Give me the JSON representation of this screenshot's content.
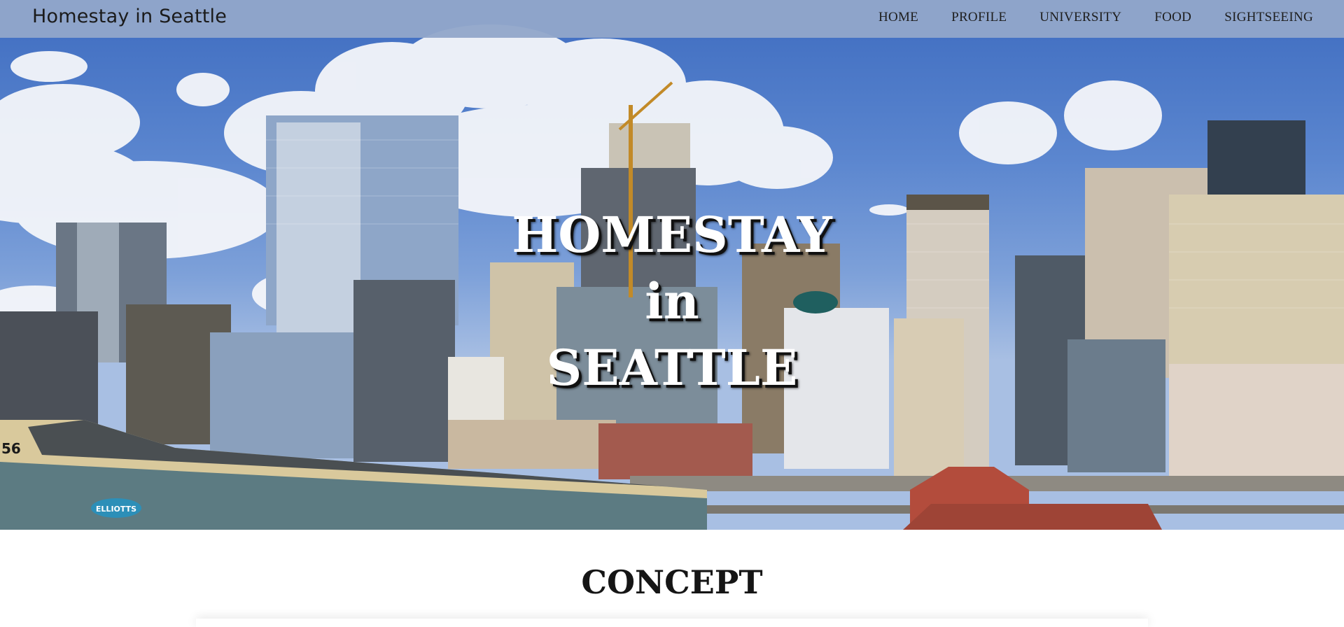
{
  "navbar": {
    "brand": "Homestay in Seattle",
    "links": [
      {
        "label": "HOME"
      },
      {
        "label": "PROFILE"
      },
      {
        "label": "UNIVERSITY"
      },
      {
        "label": "FOOD"
      },
      {
        "label": "SIGHTSEEING"
      }
    ]
  },
  "hero": {
    "title_lines": [
      "HOMESTAY",
      "in",
      "SEATTLE"
    ],
    "pier_number": "56",
    "pier_sign": "ELLIOTTS"
  },
  "concept": {
    "heading": "CONCEPT"
  },
  "colors": {
    "navbar_bg": "#92a7ca",
    "sky": "#5b86cf",
    "hero_text": "#ffffff"
  }
}
